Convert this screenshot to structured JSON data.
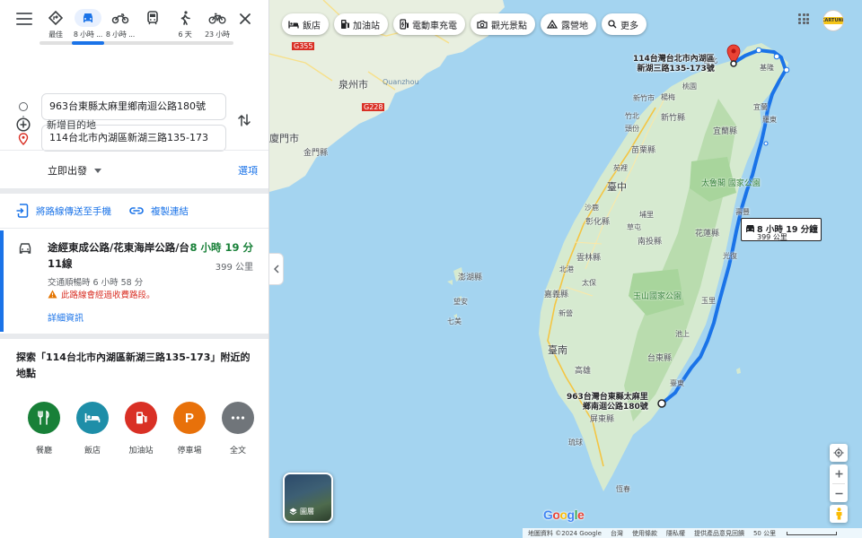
{
  "modes": [
    {
      "label": "最佳",
      "icon": "best-route-icon"
    },
    {
      "label": "8 小時 ...",
      "icon": "car-icon",
      "selected": true
    },
    {
      "label": "8 小時 ...",
      "icon": "motorcycle-icon"
    },
    {
      "label": "",
      "icon": "transit-icon"
    },
    {
      "label": "6 天",
      "icon": "walk-icon"
    },
    {
      "label": "23 小時",
      "icon": "bicycle-icon"
    }
  ],
  "waypoints": {
    "from": "963台東縣太麻里鄉南迴公路180號",
    "to": "114台北市內湖區新湖三路135-173",
    "add": "新增目的地"
  },
  "depart": {
    "label": "立即出發",
    "options": "選項"
  },
  "share": {
    "send": "將路線傳送至手機",
    "copy": "複製連結"
  },
  "route": {
    "via": "途經東成公路/花東海岸公路/台11線",
    "duration": "8 小時 19 分",
    "distance": "399 公里",
    "traffic": "交通順暢時 6 小時 58 分",
    "warning": "此路線會經過收費路段。",
    "details": "詳細資訊"
  },
  "explore": {
    "title": "探索「114台北市內湖區新湖三路135-173」附近的地點",
    "categories": [
      {
        "label": "餐廳",
        "color": "#188038",
        "icon": "restaurant-icon"
      },
      {
        "label": "飯店",
        "color": "#1e8ea8",
        "icon": "hotel-icon"
      },
      {
        "label": "加油站",
        "color": "#d93025",
        "icon": "gas-station-icon"
      },
      {
        "label": "停車場",
        "color": "#e8710a",
        "icon": "parking-icon"
      },
      {
        "label": "全文",
        "color": "#70757a",
        "icon": "more-icon"
      }
    ]
  },
  "chips": [
    {
      "label": "飯店",
      "icon": "hotel-icon"
    },
    {
      "label": "加油站",
      "icon": "gas-station-icon"
    },
    {
      "label": "電動車充電",
      "icon": "ev-charging-icon"
    },
    {
      "label": "觀光景點",
      "icon": "camera-icon"
    },
    {
      "label": "露營地",
      "icon": "campsite-icon"
    },
    {
      "label": "更多",
      "icon": "search-icon"
    }
  ],
  "avatar_text": "CARTUNE",
  "map": {
    "dest_label": "114台灣台北市內湖區\n新湖三路135-173號",
    "origin_label": "963台灣台東縣太麻里\n鄉南迴公路180號",
    "route_time": "8 小時 19 分鐘",
    "route_dist": "399 公里",
    "layers": "圖層",
    "labels": {
      "quanzhou": "泉州市",
      "jinmen_city": "金門縣",
      "xiamen": "廈門市",
      "mendian": "門",
      "quanzhou_sea": "Quanzhou",
      "g355": "G355",
      "g228": "G228",
      "hsinchu_city": "新竹市",
      "hsinchu": "新竹縣",
      "miaoli": "苗栗縣",
      "taichung": "臺中",
      "changhua": "彰化縣",
      "nantou": "南投縣",
      "yunlin": "雲林縣",
      "chiayi": "嘉義縣",
      "tainan": "臺南",
      "pingtung": "屏東縣",
      "kaohsiung": "高雄",
      "hualien": "花蓮縣",
      "taitung": "台東縣",
      "yilan": "宜蘭縣",
      "taroko": "太魯閣\n國家公園",
      "yushan": "玉山國家公園",
      "penghu": "澎湖縣",
      "wangan": "望安",
      "qimei": "七美",
      "hengchun": "恆春",
      "taoyuan": "桃園",
      "yilan_city": "宜蘭",
      "luodong": "羅東",
      "puli": "埔里",
      "beigang": "北港",
      "chishang": "池上",
      "liuqiu": "琉球",
      "taitung_city": "臺東",
      "taichung2": "台中",
      "xinzhu": "新竹",
      "xinpu": "新埔",
      "guanxi": "關西",
      "toufen": "頭份",
      "shalu": "沙鹿",
      "caotun": "草屯",
      "douliu": "斗六",
      "taibao": "太保",
      "xinying": "新營",
      "fengbin": "豐濱",
      "yuli": "玉里",
      "guangfu": "光復",
      "shoufeng": "壽豐",
      "taipei": "台北",
      "keelung": "基隆",
      "yuanli": "苑裡",
      "jhubei": "竹北",
      "yangmei": "楊梅",
      "puzi": "朴子"
    }
  },
  "footer": {
    "copyright": "地圖資料 ©2024 Google",
    "region": "台灣",
    "terms": "使用條款",
    "privacy": "隱私權",
    "feedback": "提供產品意見回饋",
    "scale": "50 公里"
  },
  "google": "Google"
}
